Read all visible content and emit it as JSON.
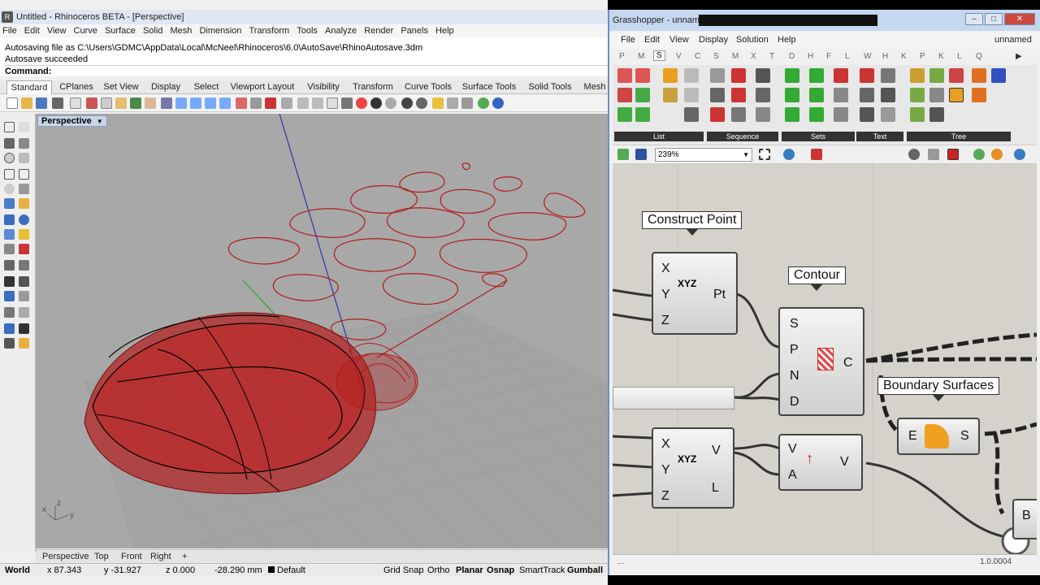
{
  "rhino": {
    "window_title": "Untitled - Rhinoceros BETA - [Perspective]",
    "menu": [
      "File",
      "Edit",
      "View",
      "Curve",
      "Surface",
      "Solid",
      "Mesh",
      "Dimension",
      "Transform",
      "Tools",
      "Analyze",
      "Render",
      "Panels",
      "Help"
    ],
    "command_history": [
      "Autosaving file as C:\\Users\\GDMC\\AppData\\Local\\McNeel\\Rhinoceros\\6.0\\AutoSave\\RhinoAutosave.3dm",
      "Autosave succeeded"
    ],
    "command_prompt": "Command:",
    "tabs": [
      "Standard",
      "CPlanes",
      "Set View",
      "Display",
      "Select",
      "Viewport Layout",
      "Visibility",
      "Transform",
      "Curve Tools",
      "Surface Tools",
      "Solid Tools",
      "Mesh"
    ],
    "active_tab": "Standard",
    "viewport_label": "Perspective",
    "view_tabs": [
      "Perspective",
      "Top",
      "Front",
      "Right"
    ],
    "add_view": "+",
    "axis_labels": {
      "x": "x",
      "y": "y",
      "z": "z"
    },
    "status": {
      "cplane": "World",
      "x": "x 87.343",
      "y": "y -31.927",
      "z": "z 0.000",
      "distance": "-28.290 mm",
      "layer": "Default",
      "grid_snap": "Grid Snap",
      "ortho": "Ortho",
      "planar": "Planar",
      "osnap": "Osnap",
      "smarttrack": "SmartTrack",
      "gumball": "Gumball"
    }
  },
  "grasshopper": {
    "window_title": "Grasshopper - unnamed",
    "menu": [
      "File",
      "Edit",
      "View",
      "Display",
      "Solution",
      "Help"
    ],
    "doc_name": "unnamed",
    "category_letters": [
      "P",
      "M",
      "S",
      "V",
      "C",
      "S",
      "M",
      "X",
      "T",
      "D",
      "H",
      "F",
      "L",
      "W",
      "H",
      "K",
      "P",
      "K",
      "L",
      "Q"
    ],
    "selected_letter": "S",
    "ribbon_groups": [
      "List",
      "Sequence",
      "Sets",
      "Text",
      "Tree"
    ],
    "zoom": "239%",
    "version": "1.0.0004",
    "status_left": "...",
    "components": {
      "construct_point": {
        "bubble": "Construct Point",
        "inputs": [
          "X",
          "Y",
          "Z"
        ],
        "outputs": [
          "Pt"
        ],
        "icon": "XYZ"
      },
      "contour": {
        "bubble": "Contour",
        "inputs": [
          "S",
          "P",
          "N",
          "D"
        ],
        "outputs": [
          "C"
        ]
      },
      "boundary": {
        "bubble": "Boundary Surfaces",
        "inputs": [
          "E"
        ],
        "outputs": [
          "S"
        ]
      },
      "vector_xyz": {
        "inputs": [
          "X",
          "Y",
          "Z"
        ],
        "outputs": [
          "V",
          "L"
        ],
        "icon": "XYZ"
      },
      "amplitude": {
        "inputs": [
          "V",
          "A"
        ],
        "outputs": [
          "V"
        ]
      },
      "partial": {
        "inputs": [
          "B"
        ]
      }
    }
  },
  "colors": {
    "accent_red": "#b31b1b",
    "gh_canvas": "#d4d2cb",
    "viewport_bg": "#a8a8a8"
  }
}
